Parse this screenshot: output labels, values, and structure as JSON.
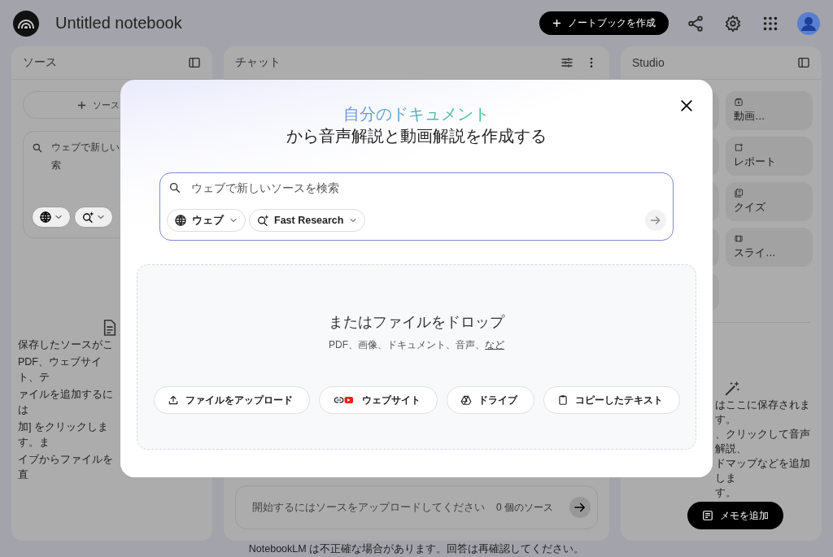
{
  "header": {
    "title": "Untitled notebook",
    "create_button": "ノートブックを作成"
  },
  "sources_panel": {
    "title": "ソース",
    "add_button": "ソース",
    "search_lines": [
      "ウェブで新しい",
      "索"
    ],
    "empty_lines": [
      "保存したソースがこ",
      "PDF、ウェブサイト、テ",
      "ァイルを追加するには",
      "加] をクリックします。ま",
      "イブからファイルを直"
    ]
  },
  "chat_panel": {
    "title": "チャット",
    "input_placeholder": "開始するにはソースをアップロードしてください",
    "source_count": "0 個のソース"
  },
  "studio_panel": {
    "title": "Studio",
    "tiles": [
      {
        "label": "動画…",
        "kind": "video"
      },
      {
        "label": "レポート",
        "kind": "report"
      },
      {
        "label": "クイズ",
        "kind": "quiz"
      },
      {
        "label": "スライ…",
        "kind": "slides"
      }
    ],
    "empty_lines": [
      "はここに保存されます。",
      "、クリックして音声解説、",
      "ドマップなどを追加しま",
      "す。"
    ],
    "add_note_button": "メモを追加"
  },
  "footer": "NotebookLM は不正確な場合があります。回答は再確認してください。",
  "dialog": {
    "title_highlight": "自分のドキュメント",
    "title_rest": "から音声解説と動画解説を作成する",
    "search_placeholder": "ウェブで新しいソースを検索",
    "chips": [
      {
        "label": "ウェブ",
        "kind": "globe"
      },
      {
        "label": "Fast Research",
        "kind": "research"
      }
    ],
    "drop_heading": "またはファイルをドロップ",
    "drop_subtext": "PDF、画像、ドキュメント、音声、",
    "drop_link": "など",
    "buttons": [
      {
        "label": "ファイルをアップロード",
        "kind": "upload"
      },
      {
        "label": "ウェブサイト",
        "kind": "link-video"
      },
      {
        "label": "ドライブ",
        "kind": "drive"
      },
      {
        "label": "コピーしたテキスト",
        "kind": "clipboard"
      }
    ]
  }
}
